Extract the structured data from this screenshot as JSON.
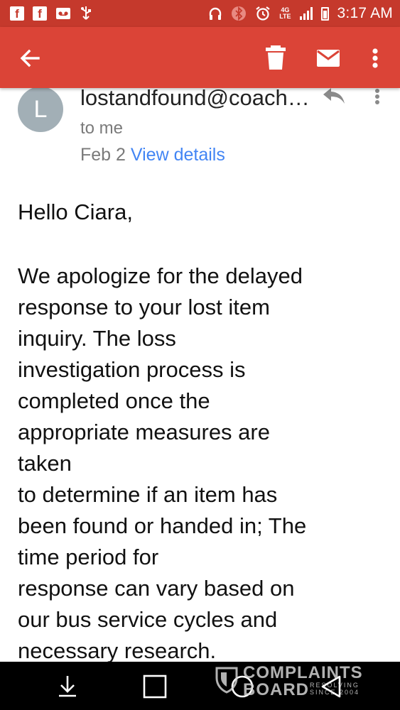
{
  "status_bar": {
    "time": "3:17 AM",
    "network": "4G LTE"
  },
  "colors": {
    "status_bar": "#c5392c",
    "app_bar": "#db4437",
    "link": "#4285f4",
    "avatar": "#a2afb6"
  },
  "message": {
    "avatar_letter": "L",
    "sender": "lostandfound@coach.com",
    "recipient": "to me",
    "date": "Feb 2",
    "view_details_label": "View details"
  },
  "body": {
    "greeting": "Hello Ciara,",
    "lines": [
      "We apologize for the delayed",
      "response to your lost item",
      "inquiry. The loss",
      "investigation process is",
      "completed once the",
      "appropriate measures are",
      "taken",
      "to determine if an item has",
      "been found or handed in; The",
      "time period for",
      "response can vary based on",
      "our bus service cycles and",
      "necessary research."
    ]
  },
  "watermark": {
    "line1": "COMPLAINTS",
    "line2": "BOARD",
    "line3": "RESOLVING SINCE 2004"
  },
  "icons": {
    "app_bar": [
      "back-arrow-icon",
      "trash-icon",
      "mail-icon",
      "more-vert-icon"
    ],
    "message": [
      "reply-icon",
      "more-vert-icon"
    ],
    "nav_bar": [
      "download-icon",
      "recents-icon",
      "home-icon",
      "back-icon"
    ]
  }
}
